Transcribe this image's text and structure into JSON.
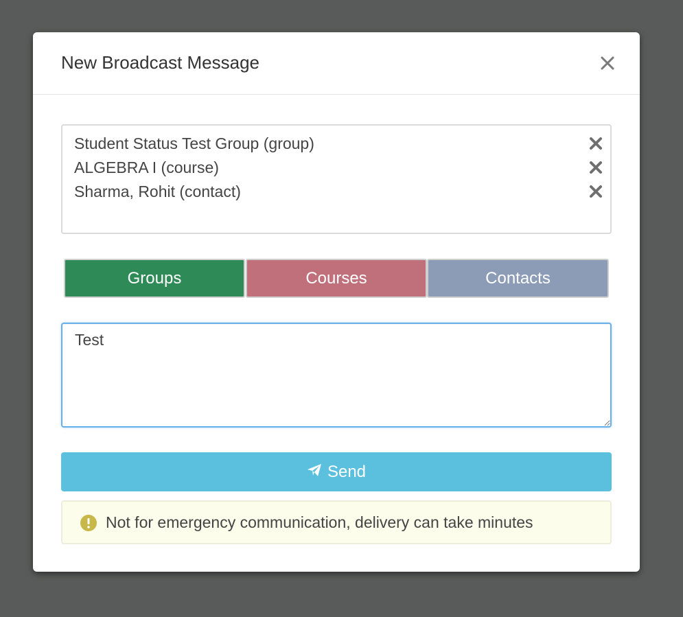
{
  "colors": {
    "backdrop": "#595b5a",
    "groups_tab": "#2e8b57",
    "courses_tab": "#c0707a",
    "contacts_tab": "#8c9bb6",
    "send_button": "#5bc0de",
    "warning_background": "#fdfdec",
    "warning_icon": "#c8b84a",
    "focus_border": "#66afe9"
  },
  "modal": {
    "title": "New Broadcast Message",
    "close_icon": "close-icon"
  },
  "recipients": [
    {
      "label": "Student Status Test Group (group)",
      "remove_icon": "remove-icon"
    },
    {
      "label": "ALGEBRA I (course)",
      "remove_icon": "remove-icon"
    },
    {
      "label": "Sharma, Rohit (contact)",
      "remove_icon": "remove-icon"
    }
  ],
  "tabs": [
    {
      "label": "Groups"
    },
    {
      "label": "Courses"
    },
    {
      "label": "Contacts"
    }
  ],
  "message": {
    "value": "Test"
  },
  "send": {
    "label": "Send",
    "icon": "paper-plane-icon"
  },
  "warning": {
    "icon": "exclamation-circle-icon",
    "text": "Not for emergency communication, delivery can take minutes"
  }
}
